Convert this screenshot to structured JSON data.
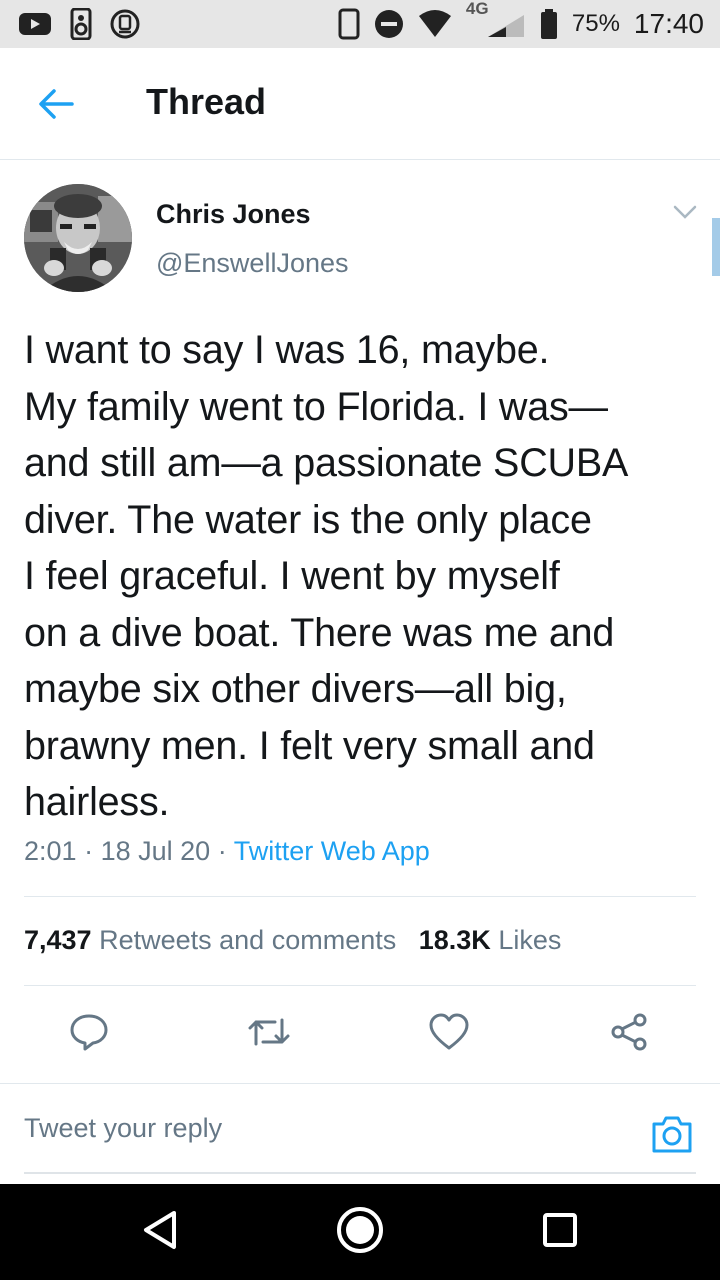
{
  "status_bar": {
    "network": "4G",
    "battery_percent": "75%",
    "time": "17:40"
  },
  "header": {
    "title": "Thread"
  },
  "tweet": {
    "author_name": "Chris Jones",
    "author_handle": "@EnswellJones",
    "text": "I want to say I was 16, maybe.\nMy family went to Florida. I was—\nand still am—a passionate SCUBA\ndiver. The water is the only place\nI feel graceful. I went by myself\non a dive boat. There was me and\nmaybe six other divers—all big,\nbrawny men. I felt very small and\nhairless.",
    "time": "2:01",
    "date": "18 Jul 20",
    "separator": "·",
    "source_app": "Twitter Web App",
    "retweets_count": "7,437",
    "retweets_label": "Retweets and comments",
    "likes_count": "18.3K",
    "likes_label": "Likes"
  },
  "reply": {
    "placeholder": "Tweet your reply"
  },
  "icons": {
    "back": "arrow-left-icon",
    "caret": "chevron-down-icon",
    "reply": "comment-icon",
    "retweet": "retweet-icon",
    "like": "heart-icon",
    "share": "share-icon",
    "camera": "camera-icon"
  },
  "colors": {
    "accent": "#1da1f2",
    "secondary_text": "#657786",
    "primary_text": "#14171a",
    "status_bar": "#e6e6e6",
    "nav_bar": "#000000"
  }
}
